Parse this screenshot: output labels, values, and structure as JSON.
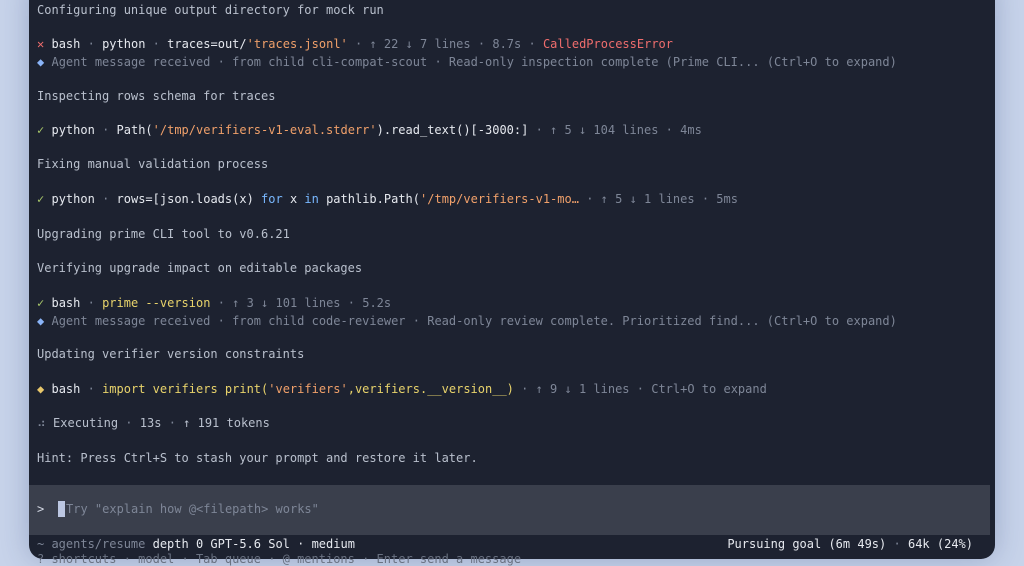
{
  "log": {
    "l1": "Configuring unique output directory for mock run",
    "l2": {
      "icon": "✕",
      "tool": "bash",
      "sep1": "·",
      "lang": "python",
      "sep2": "·",
      "cmd_a": "traces=out/",
      "cmd_str": "'traces.jsonl'",
      "sep3": "·",
      "delta": "↑ 22 ↓ 7 lines",
      "sep4": "·",
      "time": "8.7s",
      "sep5": "·",
      "error": "CalledProcessError"
    },
    "l3": {
      "icon": "◆",
      "text": "Agent message received",
      "sep1": "·",
      "from": "from child cli-compat-scout",
      "sep2": "·",
      "summary": "Read-only inspection complete (Prime CLI...",
      "expand": "(Ctrl+O to expand)"
    },
    "l4": "Inspecting rows schema for traces",
    "l5": {
      "icon": "✓",
      "lang": "python",
      "sep1": "·",
      "code_a": "Path(",
      "code_str": "'/tmp/verifiers-v1-eval.stderr'",
      "code_b": ").read_text()[-3000:]",
      "sep2": "·",
      "delta": "↑ 5 ↓ 104 lines",
      "sep3": "·",
      "time": "4ms"
    },
    "l6": "Fixing manual validation process",
    "l7": {
      "icon": "✓",
      "lang": "python",
      "sep1": "·",
      "code_a": "rows=[json.loads(x) ",
      "kw_for": "for",
      "code_b": " x ",
      "kw_in": "in",
      "code_c": " pathlib.Path(",
      "code_str": "'/tmp/verifiers-v1-mo…",
      "sep2": "·",
      "delta": "↑ 5 ↓ 1 lines",
      "sep3": "·",
      "time": "5ms"
    },
    "l8": "Upgrading prime CLI tool to v0.6.21",
    "l9": "Verifying upgrade impact on editable packages",
    "l10": {
      "icon": "✓",
      "tool": "bash",
      "sep1": "·",
      "cmd": "prime --version",
      "sep2": "·",
      "delta": "↑ 3 ↓ 101 lines",
      "sep3": "·",
      "time": "5.2s"
    },
    "l11": {
      "icon": "◆",
      "text": "Agent message received",
      "sep1": "·",
      "from": "from child code-reviewer",
      "sep2": "·",
      "summary": "Read-only review complete. Prioritized find...",
      "expand": "(Ctrl+O to expand)"
    },
    "l12": "Updating verifier version constraints",
    "l13": {
      "icon": "◆",
      "tool": "bash",
      "sep1": "·",
      "code_a": "import verifiers print(",
      "code_str": "'verifiers'",
      "code_b": ",verifiers.__version__)",
      "sep2": "·",
      "delta": "↑ 9 ↓ 1 lines",
      "sep3": "·",
      "expand": "Ctrl+O to expand"
    },
    "l14": {
      "icon": "⠴",
      "text": "Executing",
      "sep1": "·",
      "time": "13s",
      "sep2": "·",
      "tokens": "↑ 191 tokens"
    },
    "l15": "Hint: Press Ctrl+S to stash your prompt and restore it later."
  },
  "input": {
    "prompt": ">",
    "placeholder": "Try \"explain how @<filepath> works\""
  },
  "status": {
    "path": "~ agents/resume",
    "depth": "depth 0",
    "model": "GPT-5.6 Sol · medium",
    "goal": "Pursuing goal (6m 49s)",
    "sep": "·",
    "context": "64k (24%)"
  },
  "below_text": "? shortcuts  ·  model  ·  Tab queue  ·  @ mentions  ·  Enter send a message"
}
